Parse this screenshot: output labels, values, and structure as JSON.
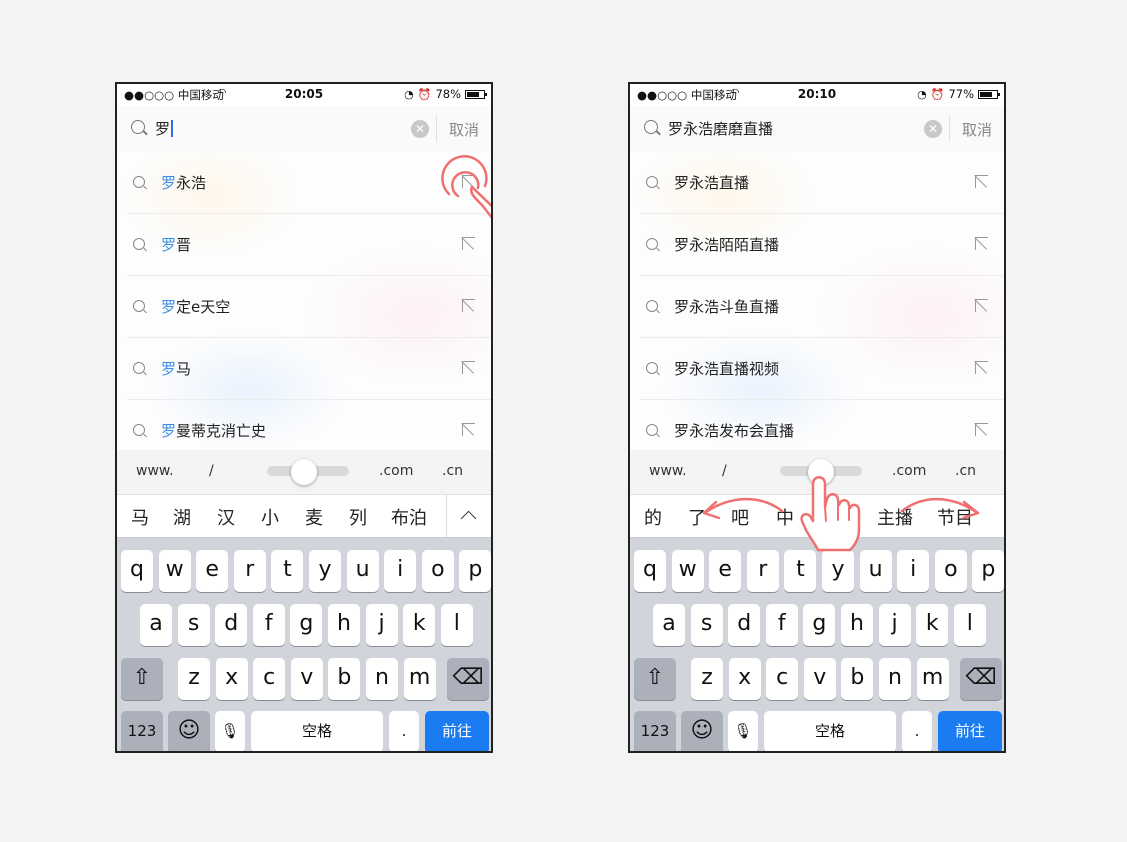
{
  "colors": {
    "accent": "#1a7cf0",
    "highlight": "#3a8ee6",
    "gesture": "#f07070"
  },
  "screens": [
    {
      "status": {
        "carrier": "●●○○○ 中国移动",
        "time": "20:05",
        "battery": "78%",
        "battery_level": 0.78
      },
      "search": {
        "query": "罗",
        "cancel": "取消"
      },
      "suggestions": [
        {
          "hl": "罗",
          "rest": "永浩"
        },
        {
          "hl": "罗",
          "rest": "晋"
        },
        {
          "hl": "罗",
          "rest": "定e天空"
        },
        {
          "hl": "罗",
          "rest": "马"
        },
        {
          "hl": "罗",
          "rest": "曼蒂克消亡史"
        }
      ],
      "url_bar": {
        "www": "www.",
        "slash": "/",
        "com": ".com",
        "cn": ".cn"
      },
      "candidates": [
        "马",
        "湖",
        "汉",
        "小",
        "麦",
        "列",
        "布泊"
      ]
    },
    {
      "status": {
        "carrier": "●●○○○ 中国移动",
        "time": "20:10",
        "battery": "77%",
        "battery_level": 0.77
      },
      "search": {
        "query": "罗永浩磨磨直播",
        "cancel": "取消"
      },
      "suggestions": [
        {
          "hl": "",
          "rest": "罗永浩直播"
        },
        {
          "hl": "",
          "rest": "罗永浩陌陌直播"
        },
        {
          "hl": "",
          "rest": "罗永浩斗鱼直播"
        },
        {
          "hl": "",
          "rest": "罗永浩直播视频"
        },
        {
          "hl": "",
          "rest": "罗永浩发布会直播"
        }
      ],
      "url_bar": {
        "www": "www.",
        "slash": "/",
        "com": ".com",
        "cn": ".cn"
      },
      "candidates": [
        "的",
        "了",
        "吧",
        "中",
        "主播",
        "节目"
      ]
    }
  ],
  "keyboard": {
    "row1": [
      "q",
      "w",
      "e",
      "r",
      "t",
      "y",
      "u",
      "i",
      "o",
      "p"
    ],
    "row2": [
      "a",
      "s",
      "d",
      "f",
      "g",
      "h",
      "j",
      "k",
      "l"
    ],
    "row3": [
      "z",
      "x",
      "c",
      "v",
      "b",
      "n",
      "m"
    ],
    "numbers": "123",
    "space": "空格",
    "period": ".",
    "go": "前往"
  }
}
